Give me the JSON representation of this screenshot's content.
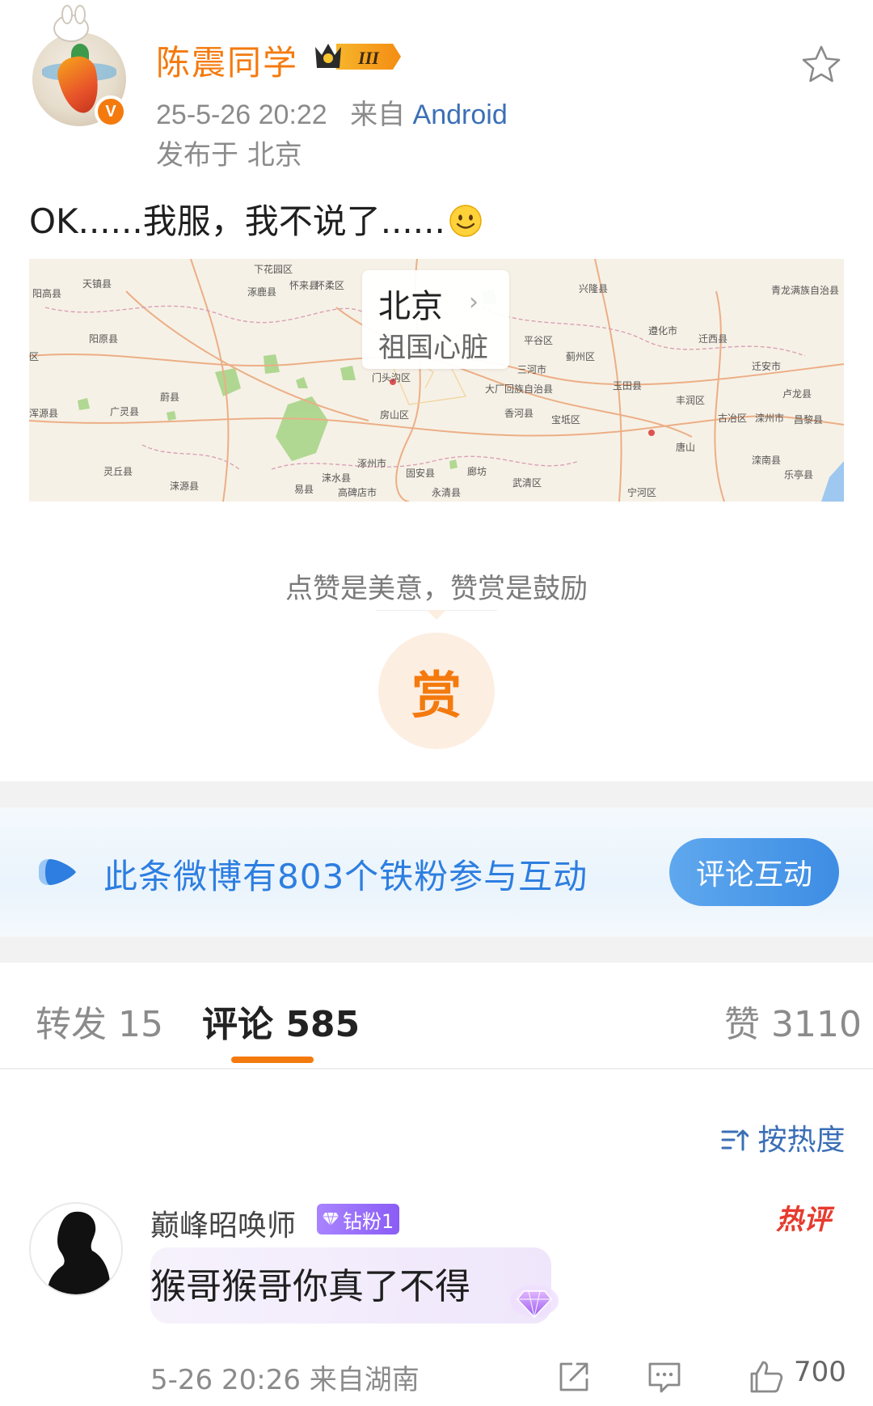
{
  "post": {
    "username": "陈震同学",
    "level_badge": "III",
    "datetime": "25-5-26 20:22",
    "from_prefix": "来自",
    "source": "Android",
    "location": "发布于 北京",
    "text": "OK......我服，我不说了......"
  },
  "map": {
    "city": "北京",
    "subtitle": "祖国心脏",
    "labels": [
      "阳高县",
      "天镇县",
      "阳原县",
      "下花园区",
      "怀来县",
      "涿鹿县",
      "蔚县",
      "广灵县",
      "灵丘县",
      "涞源县",
      "易县",
      "涞水县",
      "涿州市",
      "高碑店市",
      "固安县",
      "廊坊",
      "永清县",
      "武清区",
      "宝坻区",
      "蓟州区",
      "平谷区",
      "三河市",
      "大厂回族自治县",
      "香河县",
      "玉田县",
      "丰润区",
      "唐山",
      "古冶区",
      "滦州市",
      "迁安市",
      "迁西县",
      "遵化市",
      "兴隆县",
      "青龙满族自治县",
      "卢龙县",
      "昌黎县",
      "乐亭县",
      "滦南县",
      "宁河区",
      "门头沟区",
      "房山区",
      "怀柔区",
      "浑源县",
      "区"
    ]
  },
  "reward": {
    "slogan": "点赞是美意，赞赏是鼓励",
    "button": "赏"
  },
  "fans": {
    "text": "此条微博有803个铁粉参与互动",
    "button": "评论互动"
  },
  "tabs": {
    "repost": "转发 15",
    "comments": "评论 585",
    "likes": "赞 3110"
  },
  "sort_label": "按热度",
  "comment": {
    "username": "巅峰昭唤师",
    "badge": "钻粉1",
    "hot_tag": "热评",
    "text": "猴哥猴哥你真了不得",
    "meta": "5-26 20:26  来自湖南",
    "likes": "700"
  },
  "colors": {
    "accent_orange": "#f47a0e",
    "link_blue": "#3b6fb6",
    "fans_blue": "#2d7ee0",
    "hot_red": "#e63b2e"
  }
}
